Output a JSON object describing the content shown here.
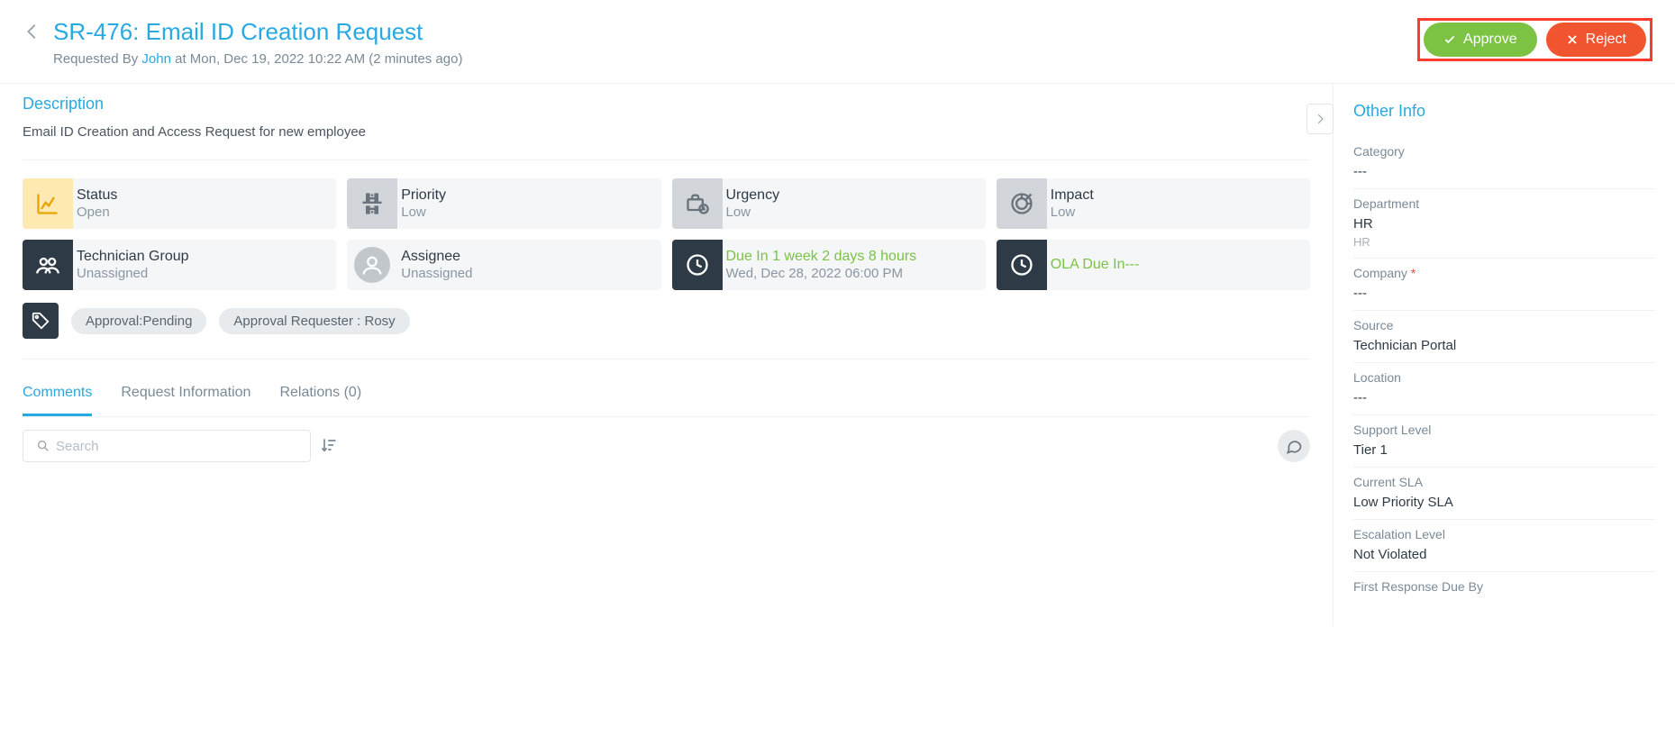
{
  "header": {
    "title": "SR-476: Email ID Creation Request",
    "requested_prefix": "Requested By ",
    "requested_user": "John",
    "requested_suffix": " at Mon, Dec 19, 2022 10:22 AM (2 minutes ago)",
    "approve_label": "Approve",
    "reject_label": "Reject"
  },
  "description": {
    "heading": "Description",
    "body": "Email ID Creation and Access Request for new employee"
  },
  "cards": {
    "status": {
      "label": "Status",
      "value": "Open"
    },
    "priority": {
      "label": "Priority",
      "value": "Low"
    },
    "urgency": {
      "label": "Urgency",
      "value": "Low"
    },
    "impact": {
      "label": "Impact",
      "value": "Low"
    },
    "tech_group": {
      "label": "Technician Group",
      "value": "Unassigned"
    },
    "assignee": {
      "label": "Assignee",
      "value": "Unassigned"
    },
    "due": {
      "label": "Due In 1 week 2 days 8 hours",
      "value": "Wed, Dec 28, 2022 06:00 PM"
    },
    "ola": {
      "label": "OLA Due In---",
      "value": ""
    }
  },
  "tags": {
    "pending": "Approval:Pending",
    "requester": "Approval Requester : Rosy"
  },
  "tabs": {
    "comments": "Comments",
    "request_info": "Request Information",
    "relations": "Relations (0)"
  },
  "search": {
    "placeholder": "Search"
  },
  "other_info": {
    "title": "Other Info",
    "category": {
      "label": "Category",
      "value": "---"
    },
    "department": {
      "label": "Department",
      "value": "HR",
      "sub": "HR"
    },
    "company": {
      "label": "Company",
      "value": "---"
    },
    "source": {
      "label": "Source",
      "value": "Technician Portal"
    },
    "location": {
      "label": "Location",
      "value": "---"
    },
    "support": {
      "label": "Support Level",
      "value": "Tier 1"
    },
    "sla": {
      "label": "Current SLA",
      "value": "Low Priority SLA"
    },
    "escalation": {
      "label": "Escalation Level",
      "value": "Not Violated"
    },
    "first_resp": {
      "label": "First Response Due By",
      "value": ""
    }
  }
}
